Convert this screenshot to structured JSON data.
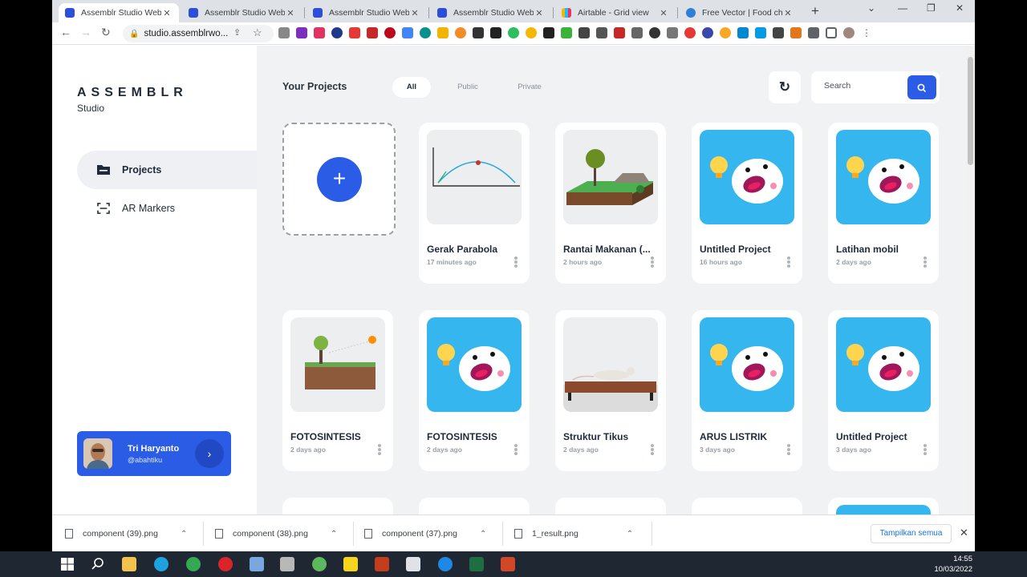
{
  "browser": {
    "tabs": [
      {
        "title": "Assemblr Studio Web",
        "fav": "assemblr",
        "active": true
      },
      {
        "title": "Assemblr Studio Web",
        "fav": "assemblr"
      },
      {
        "title": "Assemblr Studio Web",
        "fav": "assemblr"
      },
      {
        "title": "Assemblr Studio Web",
        "fav": "assemblr"
      },
      {
        "title": "Airtable - Grid view",
        "fav": "airtable"
      },
      {
        "title": "Free Vector | Food chain",
        "fav": "freevector"
      }
    ],
    "url": "studio.assemblrwo..."
  },
  "sidebar": {
    "brand": "ASSEMBLR",
    "brand_sub": "Studio",
    "items": [
      {
        "label": "Projects",
        "icon": "folder-icon",
        "active": true
      },
      {
        "label": "AR Markers",
        "icon": "scan-icon"
      }
    ],
    "user": {
      "name": "Tri Haryanto",
      "handle": "@abahtiku"
    }
  },
  "main": {
    "title": "Your Projects",
    "filters": [
      "All",
      "Public",
      "Private"
    ],
    "search_placeholder": "Search",
    "projects": [
      {
        "name": "Gerak Parabola",
        "time": "17 minutes ago",
        "thumb": "parabola"
      },
      {
        "name": "Rantai Makanan (...",
        "time": "2 hours ago",
        "thumb": "island"
      },
      {
        "name": "Untitled Project",
        "time": "16 hours ago",
        "thumb": "mascot"
      },
      {
        "name": "Latihan mobil",
        "time": "2 days ago",
        "thumb": "mascot"
      },
      {
        "name": "FOTOSINTESIS",
        "time": "2 days ago",
        "thumb": "photosynthesis"
      },
      {
        "name": "FOTOSINTESIS",
        "time": "2 days ago",
        "thumb": "mascot"
      },
      {
        "name": "Struktur Tikus",
        "time": "2 days ago",
        "thumb": "rat"
      },
      {
        "name": "ARUS LISTRIK",
        "time": "3 days ago",
        "thumb": "mascot"
      },
      {
        "name": "Untitled Project",
        "time": "3 days ago",
        "thumb": "mascot"
      }
    ]
  },
  "downloads": {
    "items": [
      "component (39).png",
      "component (38).png",
      "component (37).png",
      "1_result.png"
    ],
    "show_all": "Tampilkan semua"
  },
  "taskbar": {
    "time": "14:55",
    "date": "10/03/2022"
  },
  "colors": {
    "accent": "#2b5ce6",
    "background": "#f1f2f4",
    "mascot_bg": "#35b6ee"
  }
}
